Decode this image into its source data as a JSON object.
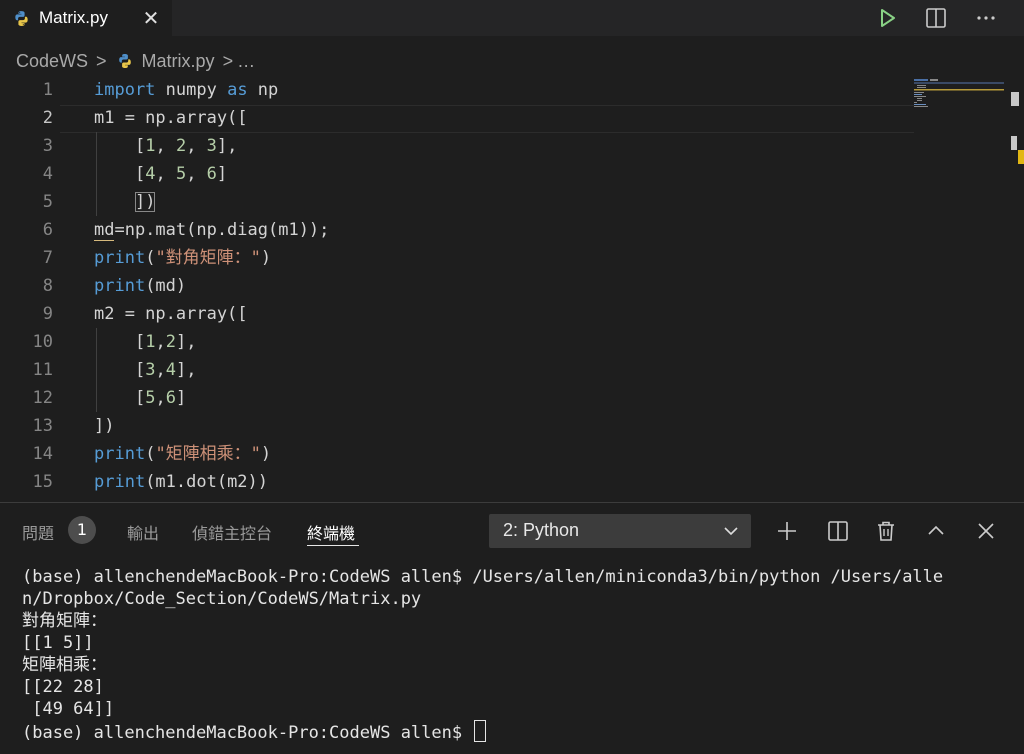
{
  "tab": {
    "icon": "python-icon",
    "label": "Matrix.py",
    "close": "✕"
  },
  "breadcrumb": {
    "folder": "CodeWS",
    "sep1": ">",
    "file": "Matrix.py",
    "sep2": ">",
    "more": "…"
  },
  "editor": {
    "lines": [
      {
        "n": "1"
      },
      {
        "n": "2"
      },
      {
        "n": "3"
      },
      {
        "n": "4"
      },
      {
        "n": "5"
      },
      {
        "n": "6"
      },
      {
        "n": "7"
      },
      {
        "n": "8"
      },
      {
        "n": "9"
      },
      {
        "n": "10"
      },
      {
        "n": "11"
      },
      {
        "n": "12"
      },
      {
        "n": "13"
      },
      {
        "n": "14"
      },
      {
        "n": "15"
      }
    ],
    "code": {
      "l1_import": "import",
      "l1_mod": " numpy ",
      "l1_as": "as",
      "l1_alias": " np",
      "l2": "m1 = np.array([",
      "l3_a": "[",
      "l3_n1": "1",
      "l3_c1": ", ",
      "l3_n2": "2",
      "l3_c2": ", ",
      "l3_n3": "3",
      "l3_b": "],",
      "l4_a": "[",
      "l4_n1": "4",
      "l4_c1": ", ",
      "l4_n2": "5",
      "l4_c2": ", ",
      "l4_n3": "6",
      "l4_b": "]",
      "l5": "])",
      "l6": "md=np.mat(np.diag(m1));",
      "l7_fn": "print",
      "l7_p1": "(",
      "l7_str": "\"對角矩陣：\"",
      "l7_p2": ")",
      "l8_fn": "print",
      "l8_rest": "(md)",
      "l9": "m2 = np.array([",
      "l10_a": "[",
      "l10_n1": "1",
      "l10_c": ",",
      "l10_n2": "2",
      "l10_b": "],",
      "l11_a": "[",
      "l11_n1": "3",
      "l11_c": ",",
      "l11_n2": "4",
      "l11_b": "],",
      "l12_a": "[",
      "l12_n1": "5",
      "l12_c": ",",
      "l12_n2": "6",
      "l12_b": "]",
      "l13": "])",
      "l14_fn": "print",
      "l14_p1": "(",
      "l14_str": "\"矩陣相乘：\"",
      "l14_p2": ")",
      "l15_fn": "print",
      "l15_rest": "(m1.dot(m2))"
    }
  },
  "panel": {
    "tabs": {
      "problems": "問題",
      "problems_count": "1",
      "output": "輸出",
      "debug": "偵錯主控台",
      "terminal": "終端機"
    },
    "terminal_select": "2: Python"
  },
  "terminal": {
    "lines": [
      "(base) allenchendeMacBook-Pro:CodeWS allen$ /Users/allen/miniconda3/bin/python /Users/alle",
      "n/Dropbox/Code_Section/CodeWS/Matrix.py",
      "對角矩陣：",
      "[[1 5]]",
      "矩陣相乘：",
      "[[22 28]",
      " [49 64]]"
    ],
    "prompt": "(base) allenchendeMacBook-Pro:CodeWS allen$ "
  },
  "colors": {
    "keyword": "#569cd6",
    "number": "#b5cea8",
    "string": "#ce9178",
    "run": "#89d185"
  }
}
